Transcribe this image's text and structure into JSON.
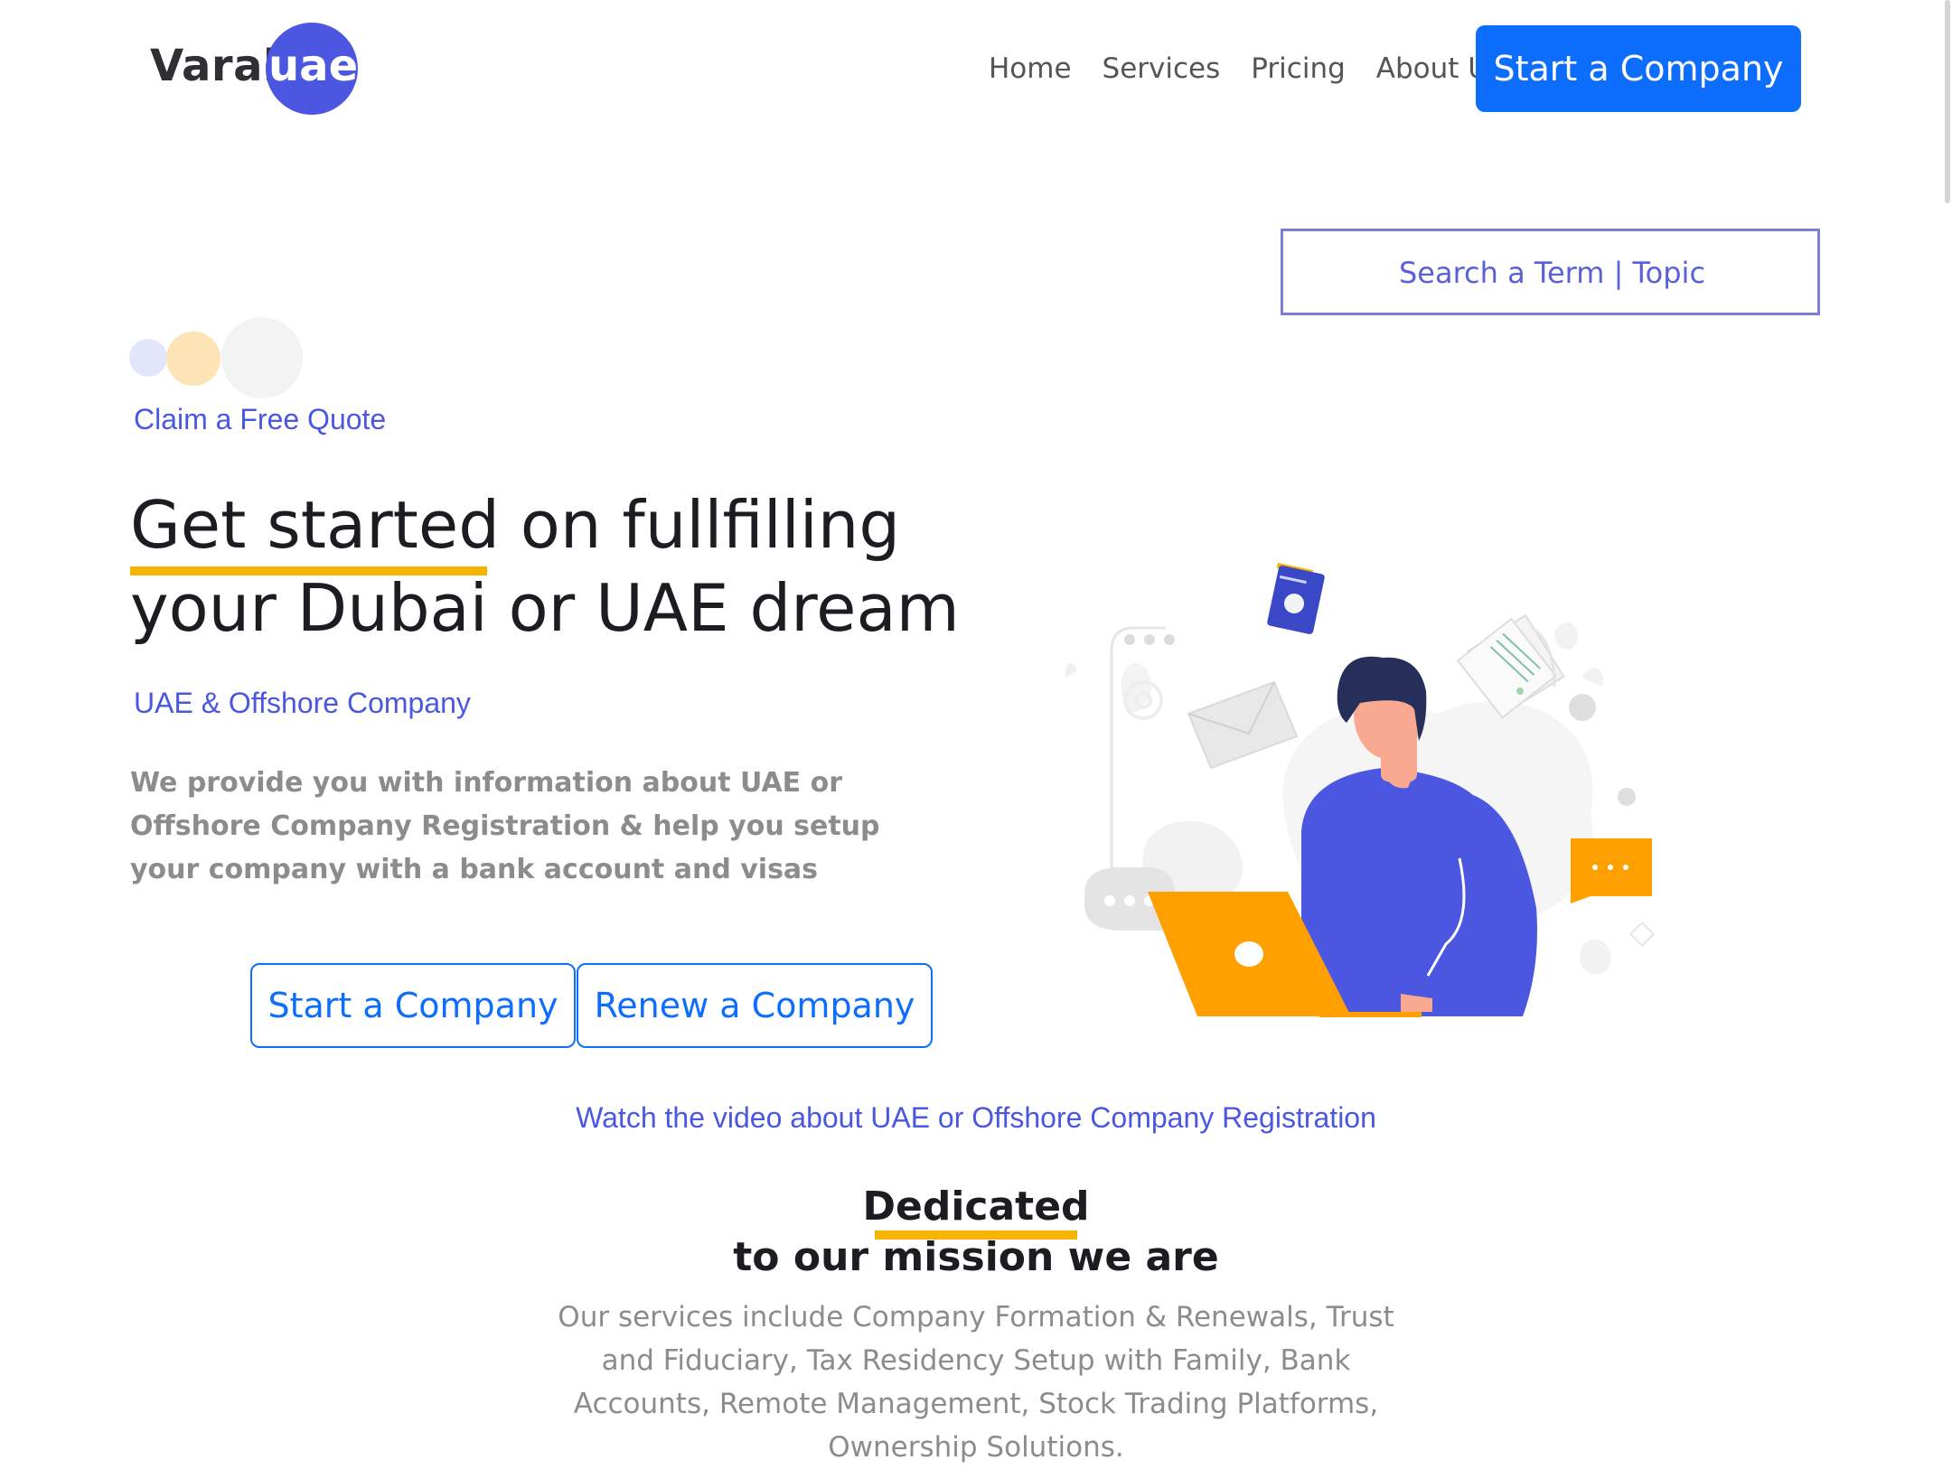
{
  "brand": {
    "name": "Varal",
    "badge": "uae",
    "badge_color": "#4b57e0"
  },
  "nav": {
    "items": [
      "Home",
      "Services",
      "Pricing",
      "About Us"
    ],
    "cta": "Start a Company"
  },
  "search": {
    "placeholder": "Search a Term | Topic"
  },
  "hero": {
    "eyebrow": "Claim a Free Quote",
    "title_line1": "Get started on fullfilling",
    "title_line2": "your Dubai or UAE dream",
    "subtitle": "UAE & Offshore Company",
    "description": "We provide you with information about UAE or Offshore Company Registration & help you setup your company with a bank account and visas",
    "buttons": {
      "start": "Start a Company",
      "renew": "Renew a Company"
    }
  },
  "video": {
    "link": "Watch the video about UAE or Offshore Company Registration"
  },
  "mission": {
    "title_line1": "Dedicated",
    "title_line2": "to our mission we are",
    "description": "Our services include Company Formation & Renewals, Trust and Fiduciary, Tax Residency Setup with Family, Bank Accounts, Remote Management, Stock Trading Platforms, Ownership Solutions."
  },
  "colors": {
    "primary": "#0d6efd",
    "accent_yellow": "#f5b400",
    "link_indigo": "#4b57e0",
    "laptop_orange": "#ffa000",
    "shirt_blue": "#4b57e0"
  },
  "icons": [
    "passport-icon",
    "mail-icon",
    "document-icon",
    "chat-bubble-icon"
  ]
}
